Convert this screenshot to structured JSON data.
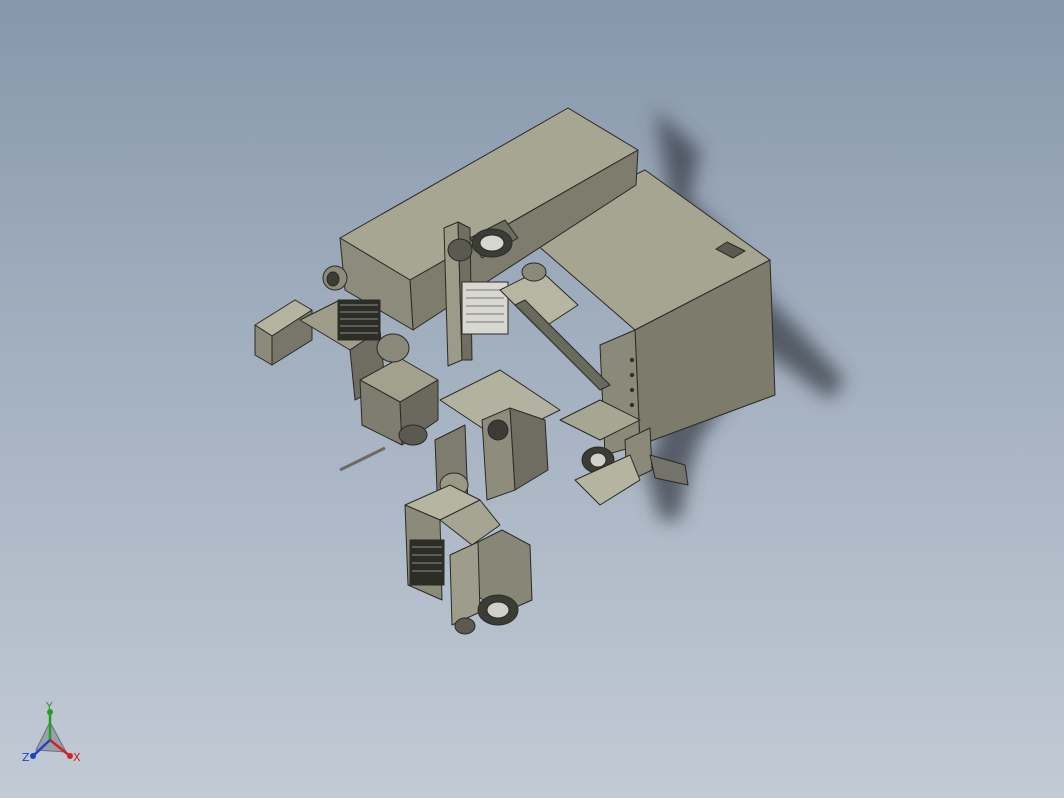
{
  "triad": {
    "x_label": "X",
    "y_label": "Y",
    "z_label": "Z",
    "x_color": "#d42020",
    "y_color": "#20a020",
    "z_color": "#2040d0"
  },
  "scene": {
    "background_top": "#8797ab",
    "background_bottom": "#c2cad5",
    "model_color": "#8f8e7e",
    "shadow_color": "#3a3f48"
  }
}
